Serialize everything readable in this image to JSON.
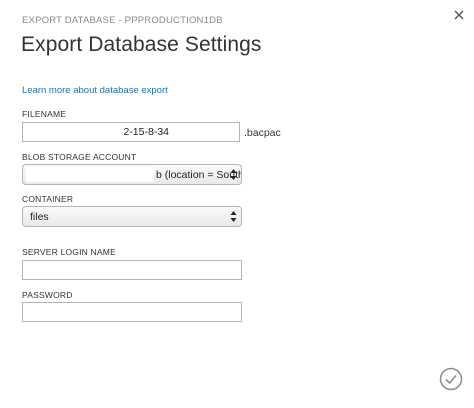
{
  "header": {
    "subtitle": "EXPORT DATABASE - PPPRODUCTION1DB",
    "title": "Export Database Settings",
    "close_icon": "close-icon"
  },
  "learn_more": {
    "text": "Learn more about database export"
  },
  "fields": {
    "filename": {
      "label": "FILENAME",
      "value": "2-15-8-34",
      "suffix": ".bacpac"
    },
    "blob_storage_account": {
      "label": "BLOB STORAGE ACCOUNT",
      "value": "b (location = Southeas"
    },
    "container": {
      "label": "CONTAINER",
      "value": "files"
    },
    "server_login_name": {
      "label": "SERVER LOGIN NAME",
      "value": ""
    },
    "password": {
      "label": "PASSWORD",
      "value": ""
    }
  },
  "footer": {
    "confirm_icon": "checkmark-circle-icon"
  },
  "colors": {
    "link": "#1f6fb5",
    "subtitle": "#8a8a8a",
    "border": "#b4b4b4"
  }
}
